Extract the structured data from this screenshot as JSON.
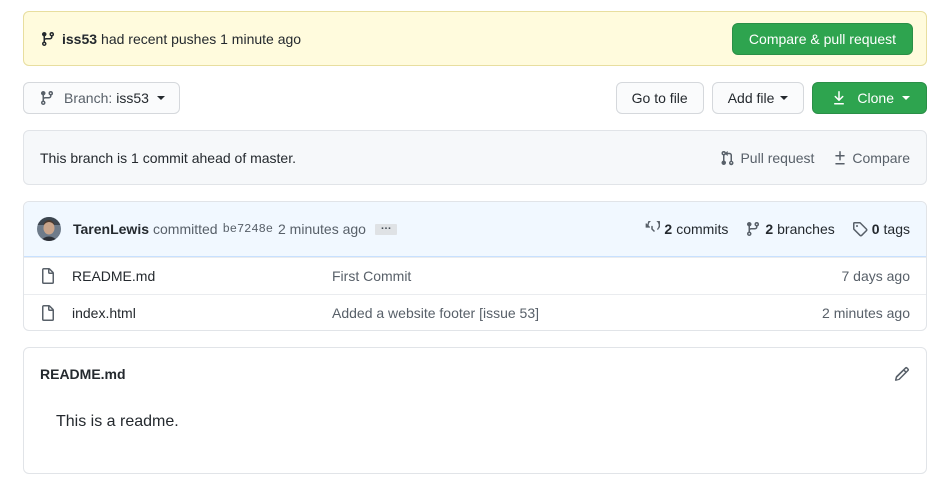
{
  "banner": {
    "branch": "iss53",
    "message": "had recent pushes 1 minute ago",
    "compare_button": "Compare & pull request"
  },
  "toolbar": {
    "branch_label": "Branch:",
    "branch_name": "iss53",
    "go_to_file": "Go to file",
    "add_file": "Add file",
    "clone": "Clone"
  },
  "ahead": {
    "message": "This branch is 1 commit ahead of master.",
    "pull_request": "Pull request",
    "compare": "Compare"
  },
  "latest_commit": {
    "author": "TarenLewis",
    "verb": "committed",
    "sha": "be7248e",
    "age": "2 minutes ago",
    "ellipsis": "…",
    "commits_count": "2",
    "commits_label": "commits",
    "branches_count": "2",
    "branches_label": "branches",
    "tags_count": "0",
    "tags_label": "tags"
  },
  "files": [
    {
      "name": "README.md",
      "message": "First Commit",
      "age": "7 days ago"
    },
    {
      "name": "index.html",
      "message": "Added a website footer [issue 53]",
      "age": "2 minutes ago"
    }
  ],
  "readme": {
    "title": "README.md",
    "content": "This is a readme."
  },
  "colors": {
    "green": "#2ea44f",
    "banner_bg": "#fffbdd",
    "commit_bar_bg": "#f1f8ff"
  },
  "icons": [
    "git-branch-icon",
    "download-icon",
    "git-pull-request-icon",
    "diff-icon",
    "history-icon",
    "tag-icon",
    "file-icon",
    "pencil-icon"
  ]
}
